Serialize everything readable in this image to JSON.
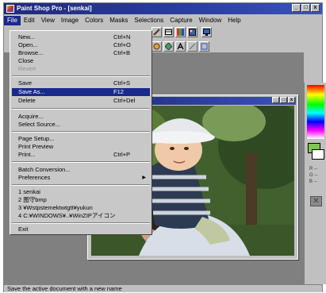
{
  "window": {
    "title": "Paint Shop Pro - [senkai]",
    "minimize_glyph": "_",
    "maximize_glyph": "□",
    "close_glyph": "x"
  },
  "menubar": {
    "items": [
      "File",
      "Edit",
      "View",
      "Image",
      "Colors",
      "Masks",
      "Selections",
      "Capture",
      "Window",
      "Help"
    ]
  },
  "file_menu": {
    "new": {
      "label": "New...",
      "shortcut": "Ctrl+N"
    },
    "open": {
      "label": "Open...",
      "shortcut": "Ctrl+O"
    },
    "browse": {
      "label": "Browse...",
      "shortcut": "Ctrl+B"
    },
    "close": {
      "label": "Close"
    },
    "revert": {
      "label": "Revert"
    },
    "save": {
      "label": "Save",
      "shortcut": "Ctrl+S"
    },
    "save_as": {
      "label": "Save As...",
      "shortcut": "F12"
    },
    "delete": {
      "label": "Delete",
      "shortcut": "Ctrl+Del"
    },
    "acquire": {
      "label": "Acquire..."
    },
    "select_source": {
      "label": "Select Source..."
    },
    "page_setup": {
      "label": "Page Setup..."
    },
    "print_preview": {
      "label": "Print Preview"
    },
    "print": {
      "label": "Print...",
      "shortcut": "Ctrl+P"
    },
    "batch_conversion": {
      "label": "Batch Conversion..."
    },
    "preferences": {
      "label": "Preferences"
    },
    "recent": [
      "1 senkai",
      "2 图守bmp",
      "3 ¥Wstpstemektwtgtt¥yukun",
      "4 C:¥WINDOWS¥..¥WinZIPアイコン"
    ],
    "exit": {
      "label": "Exit"
    }
  },
  "palette": {
    "fg_color": "#7ec850",
    "bg_color": "#ffffff",
    "r_label": "R --",
    "g_label": "G --",
    "b_label": "B --"
  },
  "statusbar": {
    "text": "Save the active document with a new name"
  }
}
